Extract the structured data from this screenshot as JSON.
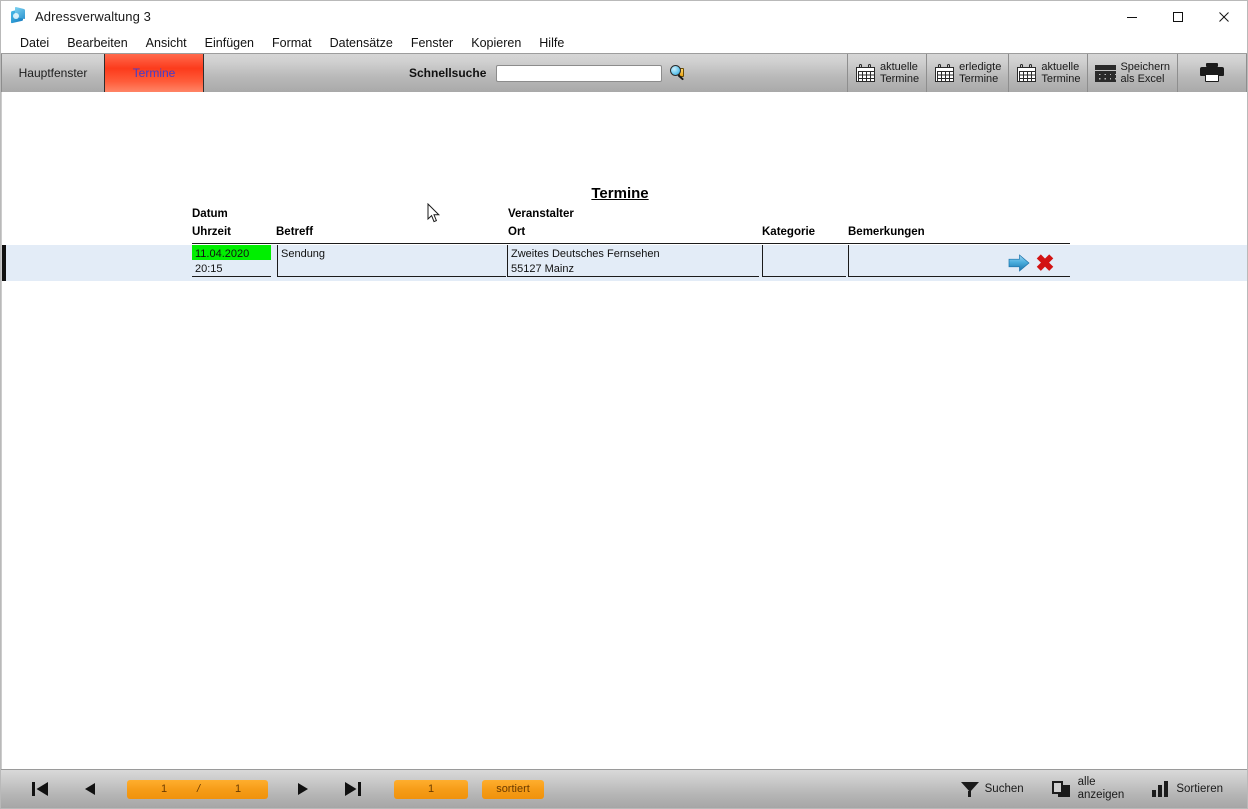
{
  "window": {
    "title": "Adressverwaltung 3",
    "icon": "app-diamond-icon",
    "controls": {
      "minimize": "minimize-icon",
      "maximize": "maximize-icon",
      "close": "close-icon"
    }
  },
  "menubar": {
    "items": [
      {
        "label": "Datei"
      },
      {
        "label": "Bearbeiten"
      },
      {
        "label": "Ansicht"
      },
      {
        "label": "Einfügen"
      },
      {
        "label": "Format"
      },
      {
        "label": "Datensätze"
      },
      {
        "label": "Fenster"
      },
      {
        "label": "Kopieren"
      },
      {
        "label": "Hilfe"
      }
    ]
  },
  "toolbar": {
    "tabs": [
      {
        "label": "Hauptfenster",
        "active": false
      },
      {
        "label": "Termine",
        "active": true
      }
    ],
    "search": {
      "label": "Schnellsuche",
      "value": "",
      "placeholder": ""
    },
    "buttons": [
      {
        "line1": "aktuelle",
        "line2": "Termine",
        "icon": "calendar-icon"
      },
      {
        "line1": "erledigte",
        "line2": "Termine",
        "icon": "calendar-icon"
      },
      {
        "line1": "aktuelle",
        "line2": "Termine",
        "icon": "calendar-icon"
      },
      {
        "line1": "Speichern",
        "line2": "als Excel",
        "icon": "table-grid-icon"
      }
    ],
    "print": {
      "icon": "printer-icon"
    }
  },
  "report": {
    "title": "Termine",
    "headers": {
      "datum": "Datum",
      "uhrzeit": "Uhrzeit",
      "betreff": "Betreff",
      "veranstalter": "Veranstalter",
      "ort": "Ort",
      "kategorie": "Kategorie",
      "bemerkungen": "Bemerkungen"
    },
    "rows": [
      {
        "datum": "11.04.2020",
        "uhrzeit": "20:15",
        "betreff": "Sendung",
        "veranstalter": "Zweites Deutsches Fernsehen",
        "ort": "55127 Mainz",
        "kategorie": "",
        "bemerkungen": "",
        "date_highlight_color": "#00ef00",
        "row_background": "#e3ecf7",
        "actions": [
          {
            "name": "goto-arrow-icon"
          },
          {
            "name": "delete-x-icon",
            "glyph": "✖"
          }
        ]
      }
    ]
  },
  "statusbar": {
    "nav": {
      "first": "first-record-icon",
      "previous": "previous-record-icon",
      "next": "next-record-icon",
      "last": "last-record-icon",
      "current_page": "1",
      "separator": "/",
      "total_pages": "1",
      "record_count": "1",
      "sort_state": "sortiert"
    },
    "buttons": [
      {
        "label": "Suchen",
        "line1": "Suchen",
        "line2": "",
        "icon": "funnel-icon"
      },
      {
        "label": "alle anzeigen",
        "line1": "alle",
        "line2": "anzeigen",
        "icon": "pages-icon"
      },
      {
        "label": "Sortieren",
        "line1": "Sortieren",
        "line2": "",
        "icon": "bars-icon"
      }
    ]
  },
  "colors": {
    "tab_active_red": "#fc3b1c",
    "tab_active_text": "#3f3fd0",
    "orange_field": "#f59b16",
    "highlight_green": "#00ef00",
    "row_blue": "#e3ecf7"
  }
}
